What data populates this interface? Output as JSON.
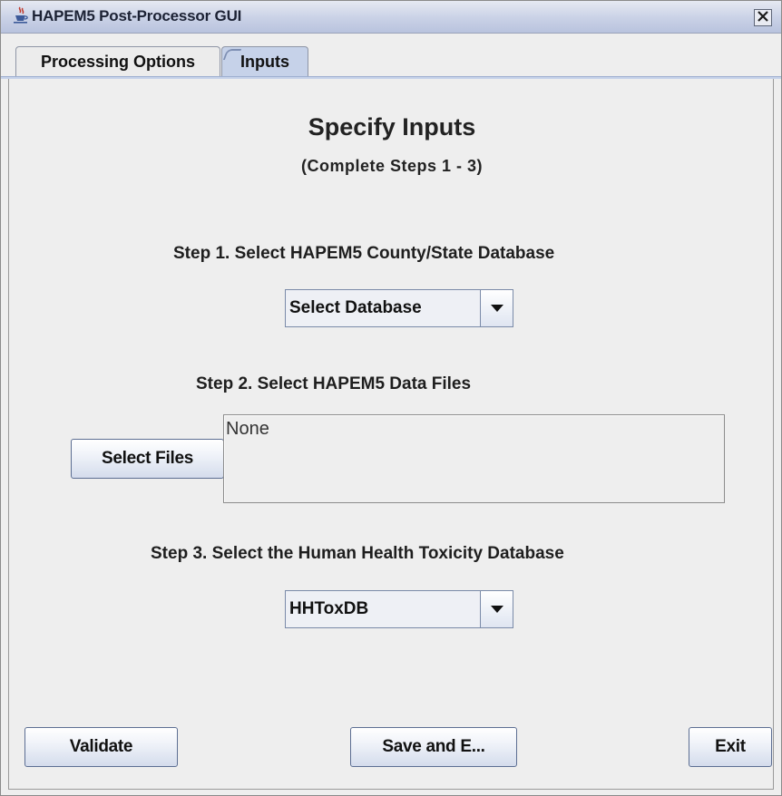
{
  "window": {
    "title": "HAPEM5 Post-Processor GUI",
    "close_glyph": "×"
  },
  "tabs": [
    {
      "label": "Processing Options",
      "selected": false
    },
    {
      "label": "Inputs",
      "selected": true
    }
  ],
  "main": {
    "title": "Specify Inputs",
    "subtitle": "(Complete Steps 1 - 3)",
    "step1": {
      "label": "Step 1. Select HAPEM5 County/State Database",
      "select_value": "Select Database"
    },
    "step2": {
      "label": "Step 2. Select HAPEM5 Data Files",
      "button_label": "Select Files",
      "files_text": "None"
    },
    "step3": {
      "label": "Step 3. Select the Human Health Toxicity Database",
      "select_value": "HHToxDB"
    }
  },
  "footer": {
    "validate_label": "Validate",
    "save_label": "Save and E...",
    "exit_label": "Exit"
  },
  "icons": {
    "app": "java-cup-icon",
    "close": "close-icon",
    "dropdown": "chevron-down-icon"
  },
  "colors": {
    "selected_tab": "#c6d2e9",
    "button_border": "#5c6e92",
    "window_bg": "#eeeeee"
  }
}
